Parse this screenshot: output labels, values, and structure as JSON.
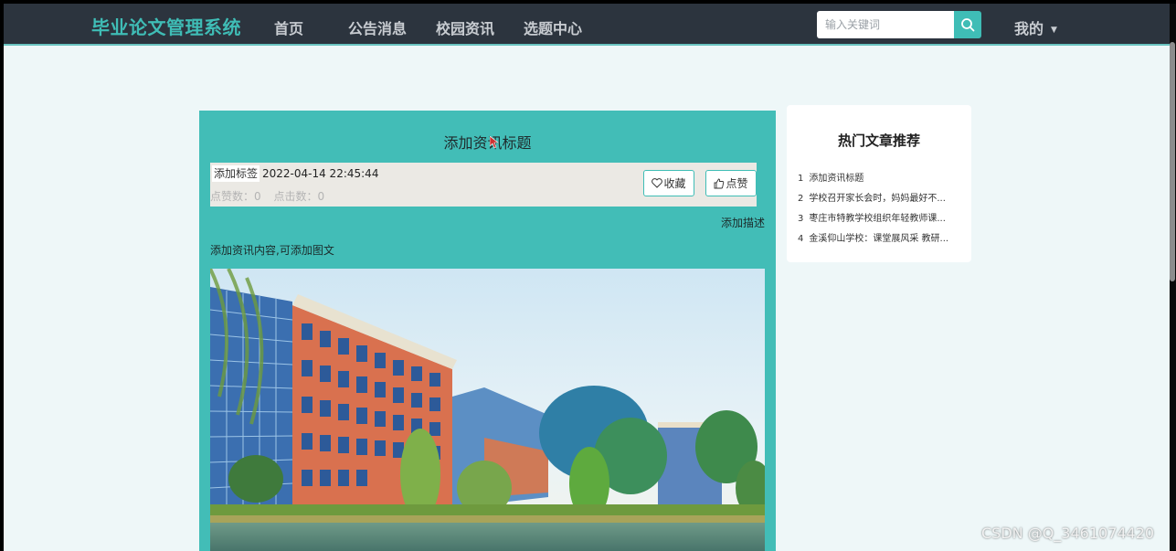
{
  "navbar": {
    "brand": "毕业论文管理系统",
    "items": [
      {
        "label": "首页"
      },
      {
        "label": "公告消息"
      },
      {
        "label": "校园资讯"
      },
      {
        "label": "选题中心"
      }
    ],
    "search_placeholder": "输入关键词",
    "user_menu": "我的",
    "accent_color": "#3fbdb6"
  },
  "article": {
    "title": "添加资讯标题",
    "tag": "添加标签",
    "date": "2022-04-14 22:45:44",
    "likes_label": "点赞数：0",
    "clicks_label": "点击数：0",
    "favorite_label": "收藏",
    "like_label": "点赞",
    "description": "添加描述",
    "content": "添加资讯内容,可添加图文",
    "image_icon": "campus-building-photo"
  },
  "sidebar": {
    "title": "热门文章推荐",
    "items": [
      {
        "num": "1",
        "text": "添加资讯标题"
      },
      {
        "num": "2",
        "text": "学校召开家长会时，妈妈最好不..."
      },
      {
        "num": "3",
        "text": "枣庄市特教学校组织年轻教师课..."
      },
      {
        "num": "4",
        "text": "金溪仰山学校：课堂展风采 教研..."
      }
    ]
  },
  "watermark": "CSDN @Q_3461074420"
}
